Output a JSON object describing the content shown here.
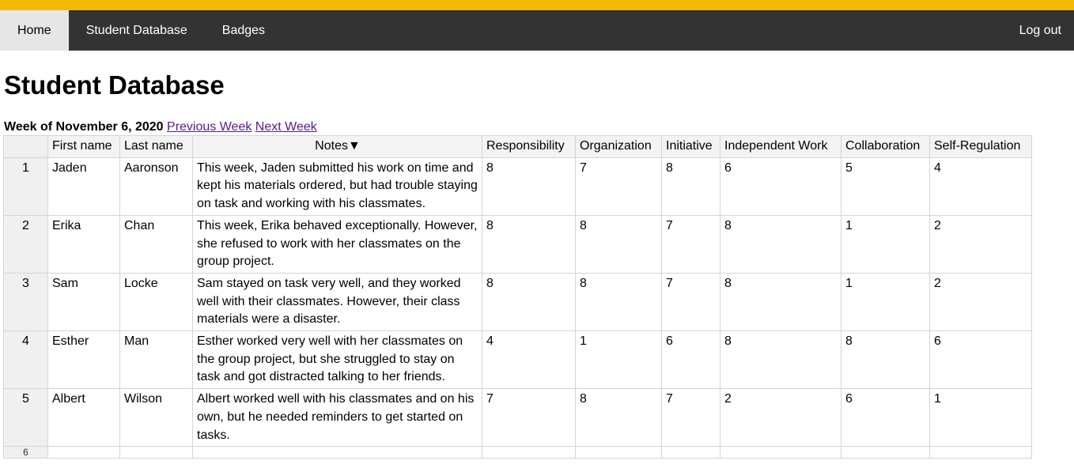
{
  "nav": {
    "home": "Home",
    "student_database": "Student Database",
    "badges": "Badges",
    "logout": "Log out"
  },
  "colors": {
    "accent_bar": "#f2b900",
    "nav_bg": "#333333",
    "active_tab_bg": "#e6e6e6",
    "link": "#551a8b"
  },
  "page": {
    "title": "Student Database",
    "week_label": "Week of November 6, 2020",
    "prev_week": "Previous Week",
    "next_week": "Next Week"
  },
  "table": {
    "headers": {
      "first_name": "First name",
      "last_name": "Last name",
      "notes": "Notes▼",
      "responsibility": "Responsibility",
      "organization": "Organization",
      "initiative": "Initiative",
      "independent_work": "Independent Work",
      "collaboration": "Collaboration",
      "self_regulation": "Self-Regulation"
    },
    "rows": [
      {
        "num": "1",
        "first": "Jaden",
        "last": "Aaronson",
        "notes": "This week, Jaden submitted his work on time and kept his materials ordered, but had trouble staying on task and working with his classmates.",
        "responsibility": "8",
        "organization": "7",
        "initiative": "8",
        "independent_work": "6",
        "collaboration": "5",
        "self_regulation": "4"
      },
      {
        "num": "2",
        "first": "Erika",
        "last": "Chan",
        "notes": "This week, Erika behaved exceptionally. However, she refused to work with her classmates on the group project.",
        "responsibility": "8",
        "organization": "8",
        "initiative": "7",
        "independent_work": "8",
        "collaboration": "1",
        "self_regulation": "2"
      },
      {
        "num": "3",
        "first": "Sam",
        "last": "Locke",
        "notes": "Sam stayed on task very well, and they worked well with their classmates. However, their class materials were a disaster.",
        "responsibility": "8",
        "organization": "8",
        "initiative": "7",
        "independent_work": "8",
        "collaboration": "1",
        "self_regulation": "2"
      },
      {
        "num": "4",
        "first": "Esther",
        "last": "Man",
        "notes": "Esther worked very well with her classmates on the group project, but she struggled to stay on task and got distracted talking to her friends.",
        "responsibility": "4",
        "organization": "1",
        "initiative": "6",
        "independent_work": "8",
        "collaboration": "8",
        "self_regulation": "6"
      },
      {
        "num": "5",
        "first": "Albert",
        "last": "Wilson",
        "notes": "Albert worked well with his classmates and on his own, but he needed reminders to get started on tasks.",
        "responsibility": "7",
        "organization": "8",
        "initiative": "7",
        "independent_work": "2",
        "collaboration": "6",
        "self_regulation": "1"
      }
    ],
    "partial_row_num": "6"
  }
}
